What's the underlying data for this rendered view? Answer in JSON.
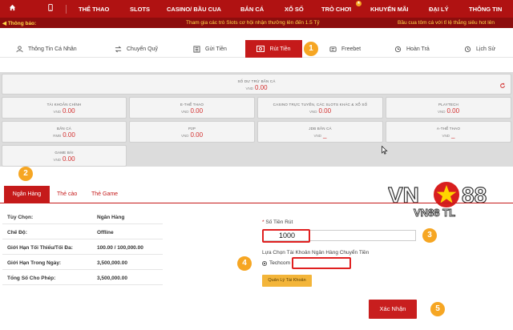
{
  "topnav": {
    "items": [
      "THỂ THAO",
      "SLOTS",
      "CASINO/ BẦU CUA",
      "BẮN CÁ",
      "XỔ SỐ",
      "TRÒ CHƠI",
      "KHUYẾN MÃI",
      "ĐẠI LÝ",
      "THÔNG TIN"
    ],
    "home_icon": "home-icon",
    "mobile_icon": "mobile-icon",
    "bg_color": "#b01212"
  },
  "ticker": {
    "label": "Thông báo:",
    "message_1": "Tham gia các trò Slots cơ hội nhận thưởng lên đến 1.5 Tỷ",
    "message_2": "Bầu cua tôm cá với tỉ lệ thắng siêu hot lên"
  },
  "account_tabs": [
    {
      "label": "Thông Tin Cá Nhân",
      "icon": "user-icon"
    },
    {
      "label": "Chuyển Quỹ",
      "icon": "transfer-icon"
    },
    {
      "label": "Gửi Tiền",
      "icon": "deposit-icon"
    },
    {
      "label": "Rút Tiền",
      "icon": "withdraw-icon",
      "active": true
    },
    {
      "label": "Freebet",
      "icon": "freebet-icon"
    },
    {
      "label": "Hoàn Trả",
      "icon": "refund-icon"
    },
    {
      "label": "Lịch Sử",
      "icon": "history-icon"
    }
  ],
  "callouts": [
    "1",
    "2",
    "3",
    "4",
    "5"
  ],
  "balances": {
    "main": {
      "name": "SỐ DƯ TRỪ BẮN CÁ",
      "currency": "VND",
      "value": "0.00"
    },
    "cells": [
      {
        "name": "TÀI KHOẢN CHÍNH",
        "currency": "VND",
        "value": "0.00"
      },
      {
        "name": "E-THỂ THAO",
        "currency": "VND",
        "value": "0.00"
      },
      {
        "name": "CASINO TRỰC TUYẾN, CÁC SLOTS KHÁC & XỔ SỐ",
        "currency": "VND",
        "value": "0.00"
      },
      {
        "name": "PLAYTECH",
        "currency": "VND",
        "value": "0.00"
      },
      {
        "name": "BẮN CÁ",
        "currency": "RMB",
        "value": "0.00"
      },
      {
        "name": "P2P",
        "currency": "VND",
        "value": "0.00"
      },
      {
        "name": "JDB BẮN CÁ",
        "currency": "VND",
        "value": "_"
      },
      {
        "name": "A-THỂ THAO",
        "currency": "VND",
        "value": "_"
      },
      {
        "name": "GAME BÀI",
        "currency": "VND",
        "value": "0.00"
      }
    ]
  },
  "method_tabs": [
    "Ngân Hàng",
    "Thẻ cào",
    "Thẻ Game"
  ],
  "info": [
    {
      "label": "Tùy Chọn:",
      "value": "Ngân Hàng"
    },
    {
      "label": "Chế Độ:",
      "value": "Offline"
    },
    {
      "label": "Giới Hạn Tối Thiểu/Tối Đa:",
      "value": "100.00 / 100,000.00"
    },
    {
      "label": "Giới Hạn Trong Ngày:",
      "value": "3,500,000.00"
    },
    {
      "label": "Tổng Số Cho Phép:",
      "value": "3,500,000.00"
    }
  ],
  "form": {
    "amount_label": "Số Tiền Rút",
    "amount_value": "1000",
    "bank_label": "Lựa Chọn Tài Khoản Ngân Hàng Chuyển Tiền",
    "bank_option": "Techcom",
    "manage_button": "Quản Lý Tài Khoản",
    "confirm_button": "Xác Nhận"
  },
  "logo": {
    "text_left": "VN",
    "text_right": "88",
    "tagline": "VN88 TL",
    "star_color": "#d81e1e",
    "star_fill": "#ffd400"
  },
  "accent_color": "#c51a1a",
  "callout_color": "#f6a623"
}
